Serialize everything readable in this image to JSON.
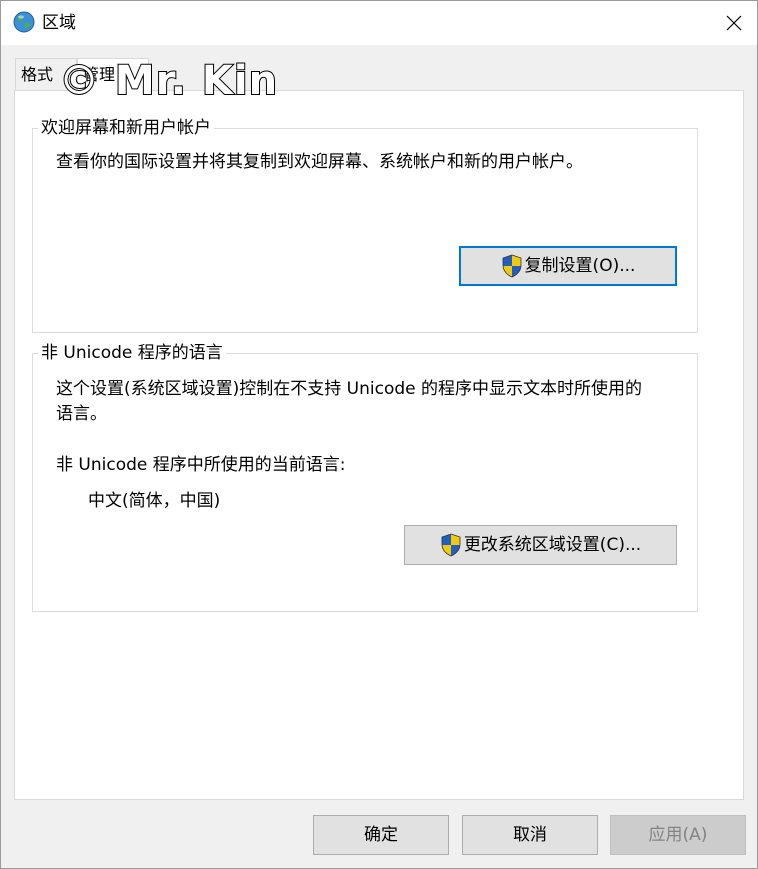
{
  "window": {
    "title": "区域",
    "icon": "globe-icon",
    "close_icon": "close-icon"
  },
  "tabs": [
    {
      "label": "格式",
      "selected": false
    },
    {
      "label": "管理",
      "selected": true
    }
  ],
  "watermark": "© Mr. Kin",
  "welcome_group": {
    "title": "欢迎屏幕和新用户帐户",
    "description": "查看你的国际设置并将其复制到欢迎屏幕、系统帐户和新的用户帐户。",
    "button_label": "复制设置(O)...",
    "button_icon": "uac-shield-icon"
  },
  "unicode_group": {
    "title": "非 Unicode 程序的语言",
    "description_line1": "这个设置(系统区域设置)控制在不支持 Unicode 的程序中显示文本时所使用的",
    "description_line2": "语言。",
    "current_label": "非 Unicode 程序中所使用的当前语言:",
    "current_value": "中文(简体，中国)",
    "button_label": "更改系统区域设置(C)...",
    "button_icon": "uac-shield-icon"
  },
  "footer": {
    "ok_label": "确定",
    "cancel_label": "取消",
    "apply_label": "应用(A)",
    "apply_enabled": false
  },
  "colors": {
    "accent": "#0078d7",
    "shield_blue": "#1f5fbf",
    "shield_yellow": "#f2c811"
  }
}
